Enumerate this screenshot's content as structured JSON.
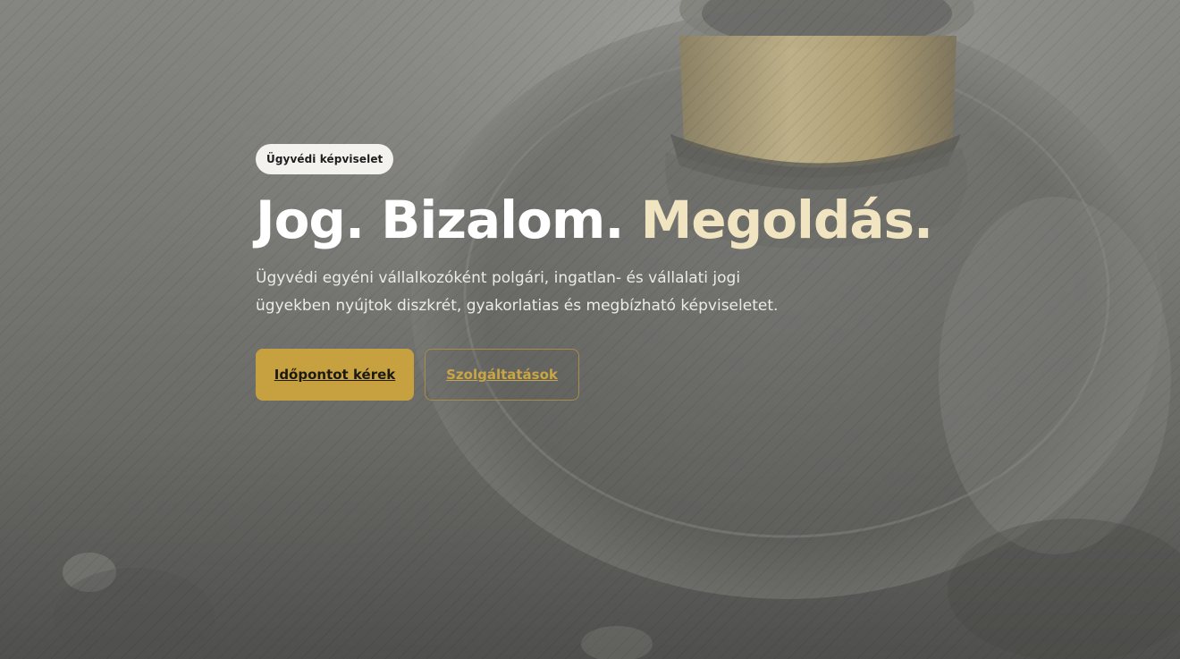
{
  "hero": {
    "badge": "Ügyvédi képviselet",
    "headline_white": "Jog. Bizalom.",
    "headline_gold": "Megoldás.",
    "lead": "Ügyvédi egyéni vállalkozóként polgári, ingatlan- és vállalati jogi ügyekben nyújtok diszkrét, gyakorlatias és megbízható képviseletet.",
    "primary_button": "Időpontot kérek",
    "secondary_button": "Szolgáltatások"
  },
  "colors": {
    "accent_gold": "#c7a13f",
    "headline_gold": "#f1e4c0",
    "outline_gold": "#a88d4a",
    "badge_bg": "#f3f2ee"
  },
  "background": {
    "image_subject": "judge-gavel-photo"
  }
}
